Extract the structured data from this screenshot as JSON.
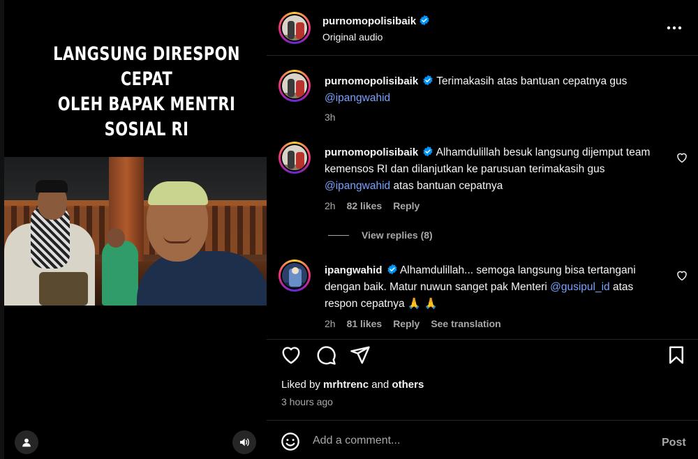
{
  "media": {
    "caption_line1": "LANGSUNG DIRESPON CEPAT",
    "caption_line2": "OLEH BAPAK MENTRI SOSIAL RI",
    "user_tag_icon": "user-icon",
    "sound_icon": "speaker-icon"
  },
  "header": {
    "username": "purnomopolisibaik",
    "audio": "Original audio",
    "more_icon": "more-horizontal-icon"
  },
  "comments": [
    {
      "username": "purnomopolisibaik",
      "text_before": "Terimakasih atas bantuan cepatnya gus ",
      "mention": "@ipangwahid",
      "text_after": "",
      "time": "3h"
    },
    {
      "username": "purnomopolisibaik",
      "text_before": "Alhamdulillah besuk langsung dijemput team kemensos RI dan dilanjutkan ke parusuan terimakasih gus ",
      "mention": "@ipangwahid",
      "text_after": " atas bantuan cepatnya",
      "time": "2h",
      "likes": "82 likes",
      "reply": "Reply",
      "view_replies": "View replies (8)"
    },
    {
      "username": "ipangwahid",
      "text_before": "Alhamdulillah... semoga langsung bisa tertangani dengan baik. Matur nuwun sanget pak Menteri ",
      "mention": "@gusipul_id",
      "text_after": " atas respon cepatnya 🙏 🙏",
      "time": "2h",
      "likes": "81 likes",
      "reply": "Reply",
      "translate": "See translation"
    }
  ],
  "actions": {
    "like_icon": "heart-icon",
    "comment_icon": "comment-icon",
    "share_icon": "send-icon",
    "save_icon": "bookmark-icon"
  },
  "liked_by": {
    "prefix": "Liked by ",
    "user": "mrhtrenc",
    "middle": " and ",
    "others": "others"
  },
  "posted": "3 hours ago",
  "comment_box": {
    "placeholder": "Add a comment...",
    "post_label": "Post",
    "emoji_icon": "emoji-icon"
  },
  "colors": {
    "background": "#000000",
    "text": "#f5f5f5",
    "muted": "#a8a8a8",
    "mention": "#7aa2ff",
    "verified": "#0095f6"
  }
}
